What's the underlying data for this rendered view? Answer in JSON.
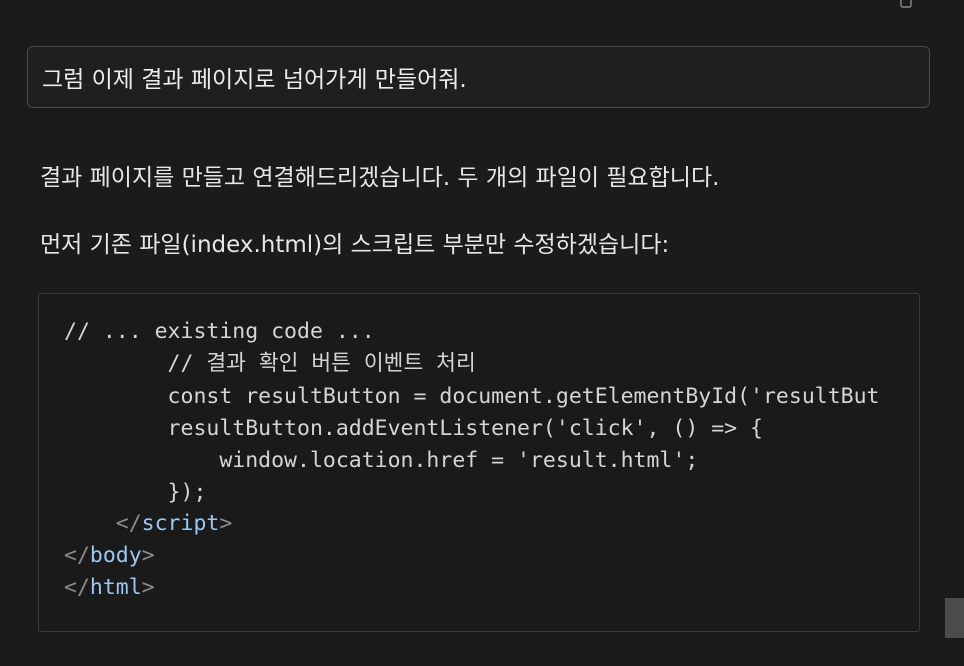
{
  "user_message": "그럼 이제 결과 페이지로 넘어가게 만들어줘.",
  "assistant": {
    "paragraph_1": "결과 페이지를 만들고 연결해드리겠습니다. 두 개의 파일이 필요합니다.",
    "paragraph_2": "먼저 기존 파일(index.html)의 스크립트 부분만 수정하겠습니다:"
  },
  "code": {
    "line_1": "// ... existing code ...",
    "line_2": "        // 결과 확인 버튼 이벤트 처리",
    "line_3": "        const resultButton = document.getElementById('resultBut",
    "line_4": "        resultButton.addEventListener('click', () => {",
    "line_5": "            window.location.href = 'result.html';",
    "line_6": "        });",
    "line_7_open": "    </",
    "line_7_tag": "script",
    "line_7_close": ">",
    "line_8_open": "</",
    "line_8_tag": "body",
    "line_8_close": ">",
    "line_9_open": "</",
    "line_9_tag": "html",
    "line_9_close": ">"
  },
  "icons": {
    "copy": "copy-icon"
  },
  "colors": {
    "background": "#1b1b1b",
    "tag_name": "#9cc7f2",
    "tag_punct": "#8a8a8a"
  }
}
